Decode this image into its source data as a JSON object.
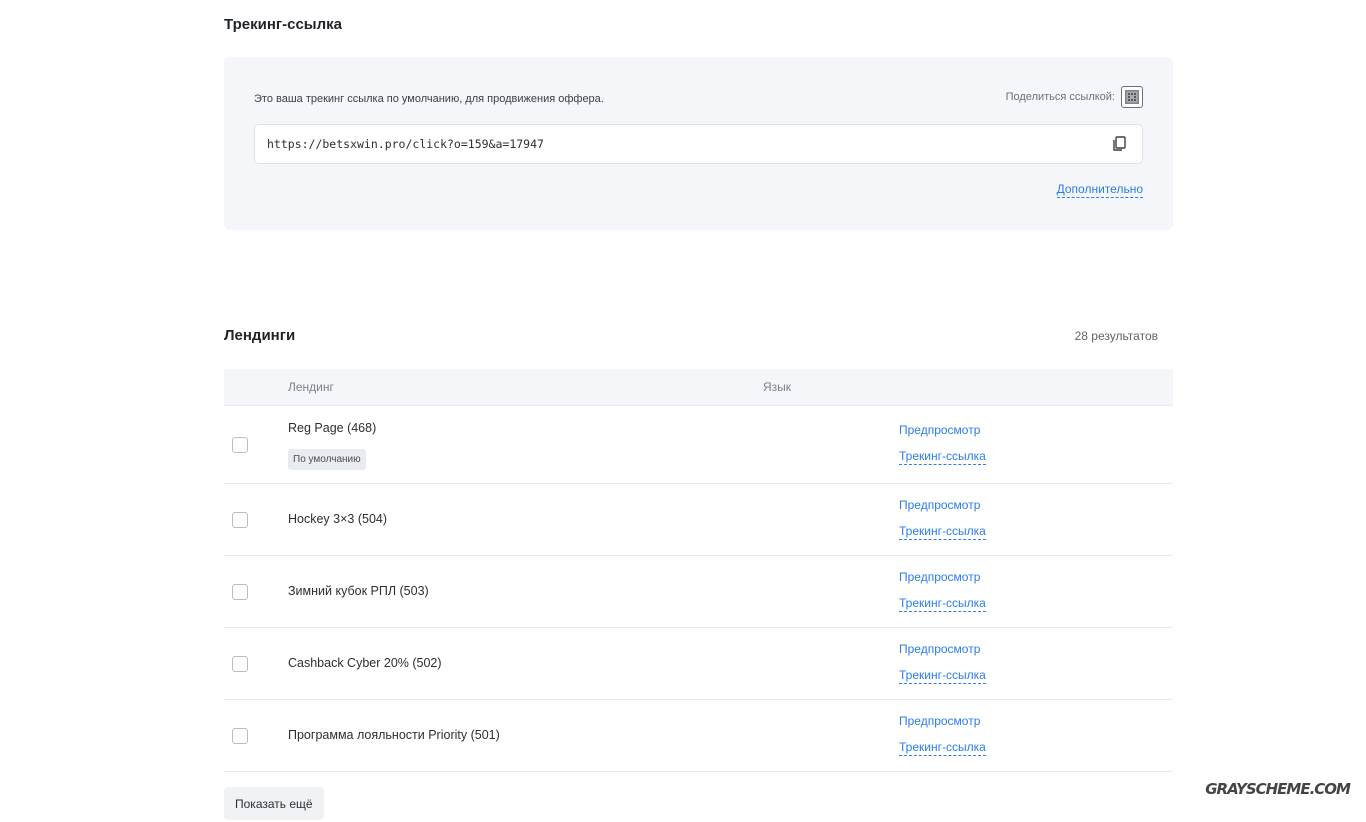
{
  "tracking": {
    "title": "Трекинг-ссылка",
    "description": "Это ваша трекинг ссылка по умолчанию, для продвижения оффера.",
    "share_label": "Поделиться ссылкой:",
    "url": "https://betsxwin.pro/click?o=159&a=17947",
    "more_label": "Дополнительно"
  },
  "landings": {
    "title": "Лендинги",
    "results": "28  результатов",
    "columns": {
      "landing": "Лендинг",
      "language": "Язык"
    },
    "rows": [
      {
        "name": "Reg Page (468)",
        "badge": "По умолчанию",
        "preview": "Предпросмотр",
        "tracking": "Трекинг-ссылка"
      },
      {
        "name": "Hockey 3×3 (504)",
        "preview": "Предпросмотр",
        "tracking": "Трекинг-ссылка"
      },
      {
        "name": "Зимний кубок РПЛ (503)",
        "preview": "Предпросмотр",
        "tracking": "Трекинг-ссылка"
      },
      {
        "name": "Cashback Cyber 20% (502)",
        "preview": "Предпросмотр",
        "tracking": "Трекинг-ссылка"
      },
      {
        "name": "Программа лояльности Priority (501)",
        "preview": "Предпросмотр",
        "tracking": "Трекинг-ссылка"
      }
    ],
    "show_more": "Показать ещё"
  },
  "watermark": "GRAYSCHEME.COM",
  "icons": {
    "qr": "qr-code-icon",
    "copy": "copy-icon"
  },
  "colors": {
    "link": "#2b7de9",
    "card_bg": "#f4f6f9"
  }
}
